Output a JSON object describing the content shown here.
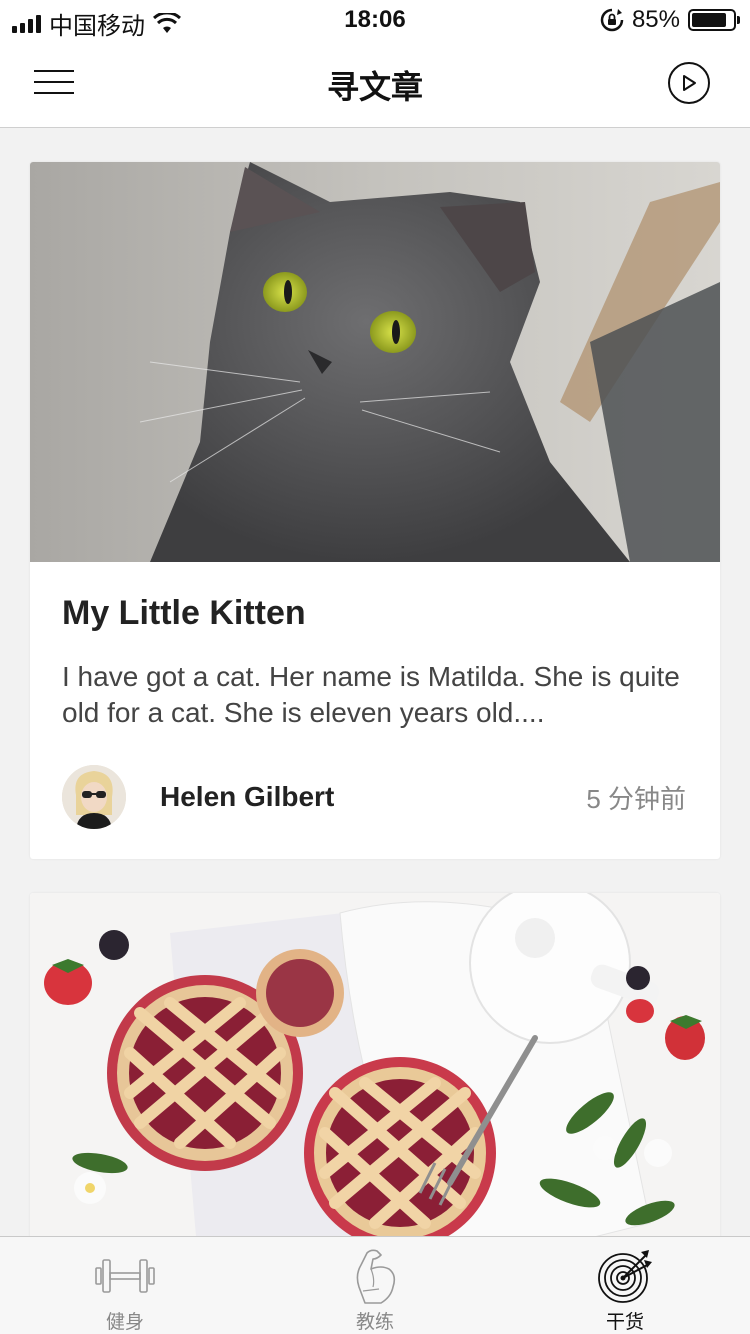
{
  "status_bar": {
    "carrier": "中国移动",
    "time": "18:06",
    "battery": "85%",
    "battery_level": 0.85,
    "icons": [
      "signal-icon",
      "wifi-icon",
      "rotation-lock-icon",
      "battery-icon"
    ]
  },
  "nav": {
    "title": "寻文章",
    "left_icon": "menu-icon",
    "right_icon": "play-icon"
  },
  "articles": [
    {
      "title": "My Little Kitten",
      "excerpt": "I have got a cat. Her name is Matilda. She is quite old for a cat. She is eleven years old....",
      "author": "Helen Gilbert",
      "time_ago": "5 分钟前",
      "image": "cat-photo"
    },
    {
      "image": "berry-pie-photo"
    }
  ],
  "tabs": [
    {
      "label": "健身",
      "icon": "dumbbell-icon",
      "active": false
    },
    {
      "label": "教练",
      "icon": "muscle-arm-icon",
      "active": false
    },
    {
      "label": "干货",
      "icon": "target-icon",
      "active": true
    }
  ]
}
